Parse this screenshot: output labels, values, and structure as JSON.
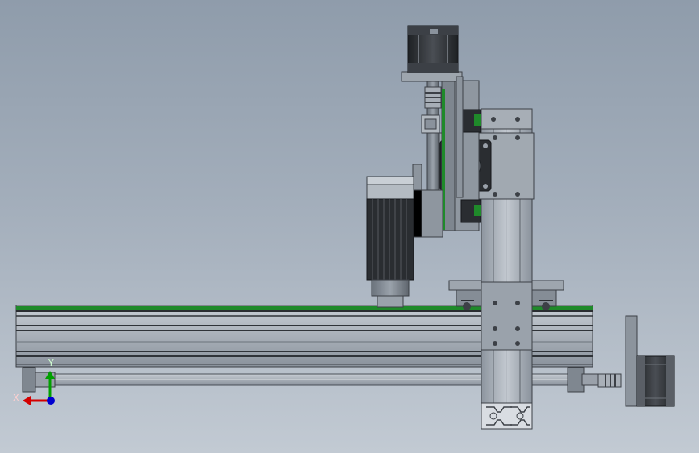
{
  "viewport": {
    "background_top": "#8f9cab",
    "background_bottom": "#c2cad3"
  },
  "triad": {
    "x_label": "X",
    "y_label": "Y",
    "x_color": "#d40000",
    "y_color": "#00a000",
    "z_color": "#0000d0"
  },
  "colors": {
    "metal_dark": "#3c4046",
    "metal_mid": "#808892",
    "metal_light": "#b9c0c8",
    "rail_green": "#1f8a2a",
    "motor_black": "#2a2d31"
  }
}
